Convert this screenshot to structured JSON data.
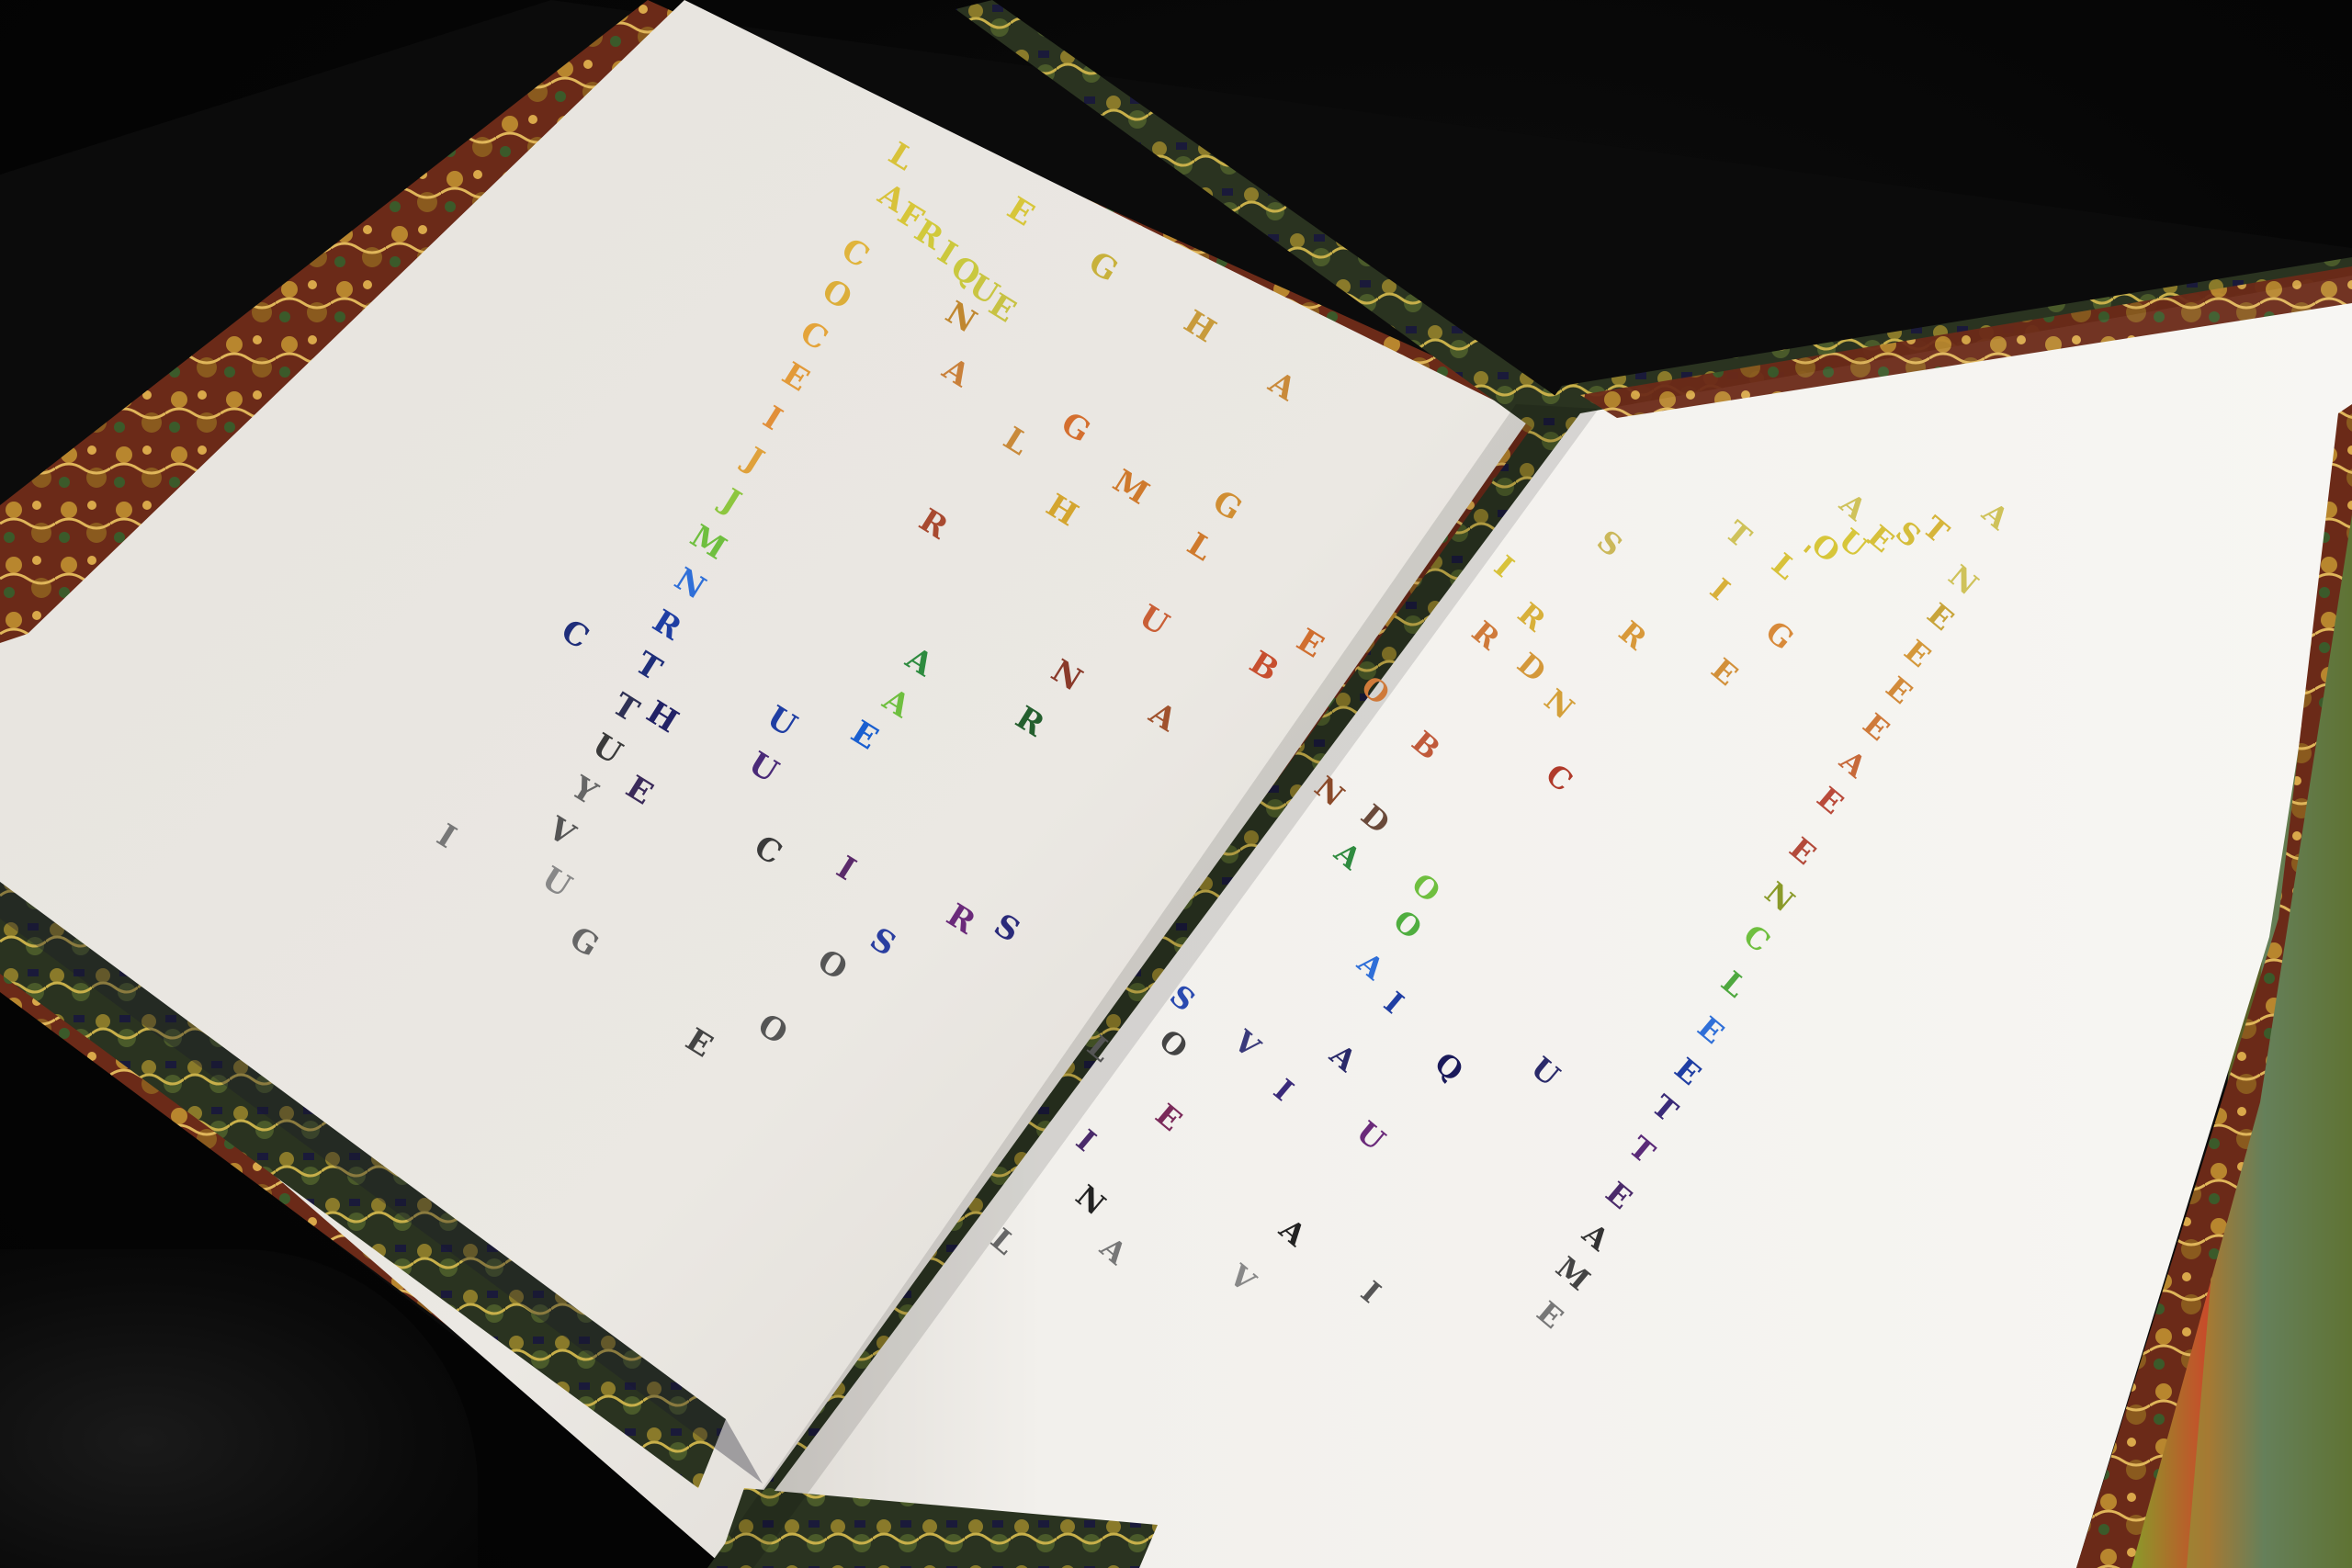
{
  "book": {
    "subject": "open art book with colorful scattered letters",
    "left_page_words": [
      "AFRIQUE"
    ],
    "right_page_words": [
      "L'OUEST"
    ]
  },
  "letters": {
    "left": [
      {
        "t": "A",
        "c": "#d8c23a"
      },
      {
        "t": "F",
        "c": "#d7c63a"
      },
      {
        "t": "R",
        "c": "#d1c93b"
      },
      {
        "t": "I",
        "c": "#ccc83d"
      },
      {
        "t": "Q",
        "c": "#c9c83f"
      },
      {
        "t": "U",
        "c": "#c9c543"
      },
      {
        "t": "E",
        "c": "#c8c244"
      },
      {
        "t": "L",
        "c": "#d8c23a"
      },
      {
        "t": "E",
        "c": "#d7c63a"
      },
      {
        "t": "G",
        "c": "#c8b13b"
      },
      {
        "t": "H",
        "c": "#c89b3c"
      },
      {
        "t": "A",
        "c": "#c98a3a"
      },
      {
        "t": "C",
        "c": "#e0b43c"
      },
      {
        "t": "O",
        "c": "#dcae3a"
      },
      {
        "t": "C",
        "c": "#e4a43a"
      },
      {
        "t": "E",
        "c": "#e29a39"
      },
      {
        "t": "I",
        "c": "#e18f39"
      },
      {
        "t": "J",
        "c": "#dfa13b"
      },
      {
        "t": "J",
        "c": "#8dc63f"
      },
      {
        "t": "M",
        "c": "#6fbf3f"
      },
      {
        "t": "N",
        "c": "#2f6fd8"
      },
      {
        "t": "R",
        "c": "#1f3ea3"
      },
      {
        "t": "T",
        "c": "#1f2e7a"
      },
      {
        "t": "T",
        "c": "#2e3054"
      },
      {
        "t": "U",
        "c": "#3a3a3a"
      },
      {
        "t": "Y",
        "c": "#666666"
      },
      {
        "t": "V",
        "c": "#555555"
      },
      {
        "t": "N",
        "c": "#c0872f"
      },
      {
        "t": "A",
        "c": "#c9803a"
      },
      {
        "t": "L",
        "c": "#c98a3a"
      },
      {
        "t": "G",
        "c": "#d46f2f"
      },
      {
        "t": "G",
        "c": "#d08e33"
      },
      {
        "t": "M",
        "c": "#cf7a2d"
      },
      {
        "t": "H",
        "c": "#d4a52f"
      },
      {
        "t": "L",
        "c": "#cf7a2d"
      },
      {
        "t": "R",
        "c": "#a84a30"
      },
      {
        "t": "U",
        "c": "#c95f36"
      },
      {
        "t": "E",
        "c": "#d06e2f"
      },
      {
        "t": "B",
        "c": "#c74f2f"
      },
      {
        "t": "N",
        "c": "#8a3a2a"
      },
      {
        "t": "A",
        "c": "#a0522d"
      },
      {
        "t": "A",
        "c": "#2e8b3f"
      },
      {
        "t": "R",
        "c": "#245f2e"
      },
      {
        "t": "A",
        "c": "#6fbf3f"
      },
      {
        "t": "E",
        "c": "#1a5fd0"
      },
      {
        "t": "U",
        "c": "#1f3ea3"
      },
      {
        "t": "C",
        "c": "#1f2e7a"
      },
      {
        "t": "H",
        "c": "#222266"
      },
      {
        "t": "U",
        "c": "#4a2a78"
      },
      {
        "t": "E",
        "c": "#3a2a5a"
      },
      {
        "t": "I",
        "c": "#5a2a6a"
      },
      {
        "t": "C",
        "c": "#3b3b3b"
      },
      {
        "t": "S",
        "c": "#2a3ea0"
      },
      {
        "t": "S",
        "c": "#2a2a7a"
      },
      {
        "t": "R",
        "c": "#6a2a7a"
      },
      {
        "t": "O",
        "c": "#555555"
      },
      {
        "t": "I",
        "c": "#777777"
      },
      {
        "t": "U",
        "c": "#888888"
      },
      {
        "t": "G",
        "c": "#666666"
      },
      {
        "t": "E",
        "c": "#444444"
      },
      {
        "t": "O",
        "c": "#555555"
      }
    ],
    "right": [
      {
        "t": "L",
        "c": "#d8c23a"
      },
      {
        "t": "'",
        "c": "#d8c23a"
      },
      {
        "t": "O",
        "c": "#d7c63a"
      },
      {
        "t": "U",
        "c": "#d7c63a"
      },
      {
        "t": "E",
        "c": "#d6c03b"
      },
      {
        "t": "S",
        "c": "#d5bd3b"
      },
      {
        "t": "T",
        "c": "#d6b53b"
      },
      {
        "t": "I",
        "c": "#d8c23a"
      },
      {
        "t": "S",
        "c": "#cbb85a"
      },
      {
        "t": "T",
        "c": "#cfc25a"
      },
      {
        "t": "A",
        "c": "#cfc25a"
      },
      {
        "t": "A",
        "c": "#cfc25a"
      },
      {
        "t": "N",
        "c": "#cfc25a"
      },
      {
        "t": "E",
        "c": "#c8a43a"
      },
      {
        "t": "E",
        "c": "#d4983a"
      },
      {
        "t": "E",
        "c": "#d28a3a"
      },
      {
        "t": "E",
        "c": "#cf7a3a"
      },
      {
        "t": "A",
        "c": "#c76a3a"
      },
      {
        "t": "E",
        "c": "#b94a3a"
      },
      {
        "t": "E",
        "c": "#b34a3a"
      },
      {
        "t": "N",
        "c": "#8a9a2a"
      },
      {
        "t": "C",
        "c": "#6fbf3f"
      },
      {
        "t": "L",
        "c": "#4fa83f"
      },
      {
        "t": "E",
        "c": "#2f6fd8"
      },
      {
        "t": "E",
        "c": "#1f3ea3"
      },
      {
        "t": "T",
        "c": "#3a2a78"
      },
      {
        "t": "T",
        "c": "#5a2a78"
      },
      {
        "t": "E",
        "c": "#4a2a6a"
      },
      {
        "t": "A",
        "c": "#333333"
      },
      {
        "t": "M",
        "c": "#444444"
      },
      {
        "t": "E",
        "c": "#777777"
      },
      {
        "t": "R",
        "c": "#d8b03a"
      },
      {
        "t": "I",
        "c": "#d8b03a"
      },
      {
        "t": "R",
        "c": "#d8993a"
      },
      {
        "t": "G",
        "c": "#d88a3a"
      },
      {
        "t": "R",
        "c": "#cf7a3a"
      },
      {
        "t": "E",
        "c": "#d2903a"
      },
      {
        "t": "D",
        "c": "#d4983a"
      },
      {
        "t": "N",
        "c": "#d4a03a"
      },
      {
        "t": "O",
        "c": "#cf7a3a"
      },
      {
        "t": "B",
        "c": "#c05a3a"
      },
      {
        "t": "C",
        "c": "#b03a2a"
      },
      {
        "t": "N",
        "c": "#8a4a2a"
      },
      {
        "t": "D",
        "c": "#6a4a3a"
      },
      {
        "t": "A",
        "c": "#2f8b3f"
      },
      {
        "t": "O",
        "c": "#6fbf3f"
      },
      {
        "t": "O",
        "c": "#4fae3f"
      },
      {
        "t": "A",
        "c": "#2f6fd8"
      },
      {
        "t": "I",
        "c": "#1f3ea3"
      },
      {
        "t": "S",
        "c": "#2a4ab0"
      },
      {
        "t": "L",
        "c": "#555555"
      },
      {
        "t": "O",
        "c": "#444444"
      },
      {
        "t": "V",
        "c": "#3a3a7a"
      },
      {
        "t": "A",
        "c": "#2a2a6a"
      },
      {
        "t": "Q",
        "c": "#1a1a5a"
      },
      {
        "t": "U",
        "c": "#2a2a6a"
      },
      {
        "t": "I",
        "c": "#3a2a7a"
      },
      {
        "t": "E",
        "c": "#7a2a5a"
      },
      {
        "t": "U",
        "c": "#6a2a7a"
      },
      {
        "t": "I",
        "c": "#4a2a6a"
      },
      {
        "t": "N",
        "c": "#222222"
      },
      {
        "t": "A",
        "c": "#222222"
      },
      {
        "t": "L",
        "c": "#666666"
      },
      {
        "t": "A",
        "c": "#777777"
      },
      {
        "t": "V",
        "c": "#888888"
      },
      {
        "t": "I",
        "c": "#555555"
      }
    ]
  }
}
